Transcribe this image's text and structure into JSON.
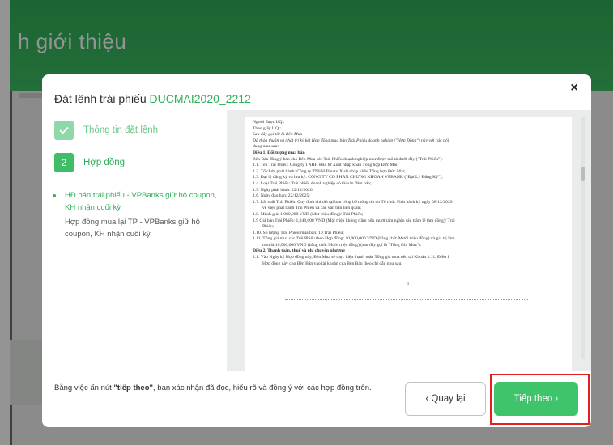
{
  "background": {
    "title": "h giới thiệu",
    "header_color": "#3ebd64"
  },
  "modal": {
    "title_prefix": "Đặt lệnh trái phiếu",
    "bond_code": "DUCMAI2020_2212",
    "close_icon": "×",
    "steps": [
      {
        "number": "",
        "label": "Thông tin đặt lệnh",
        "state": "done",
        "icon": "check-icon"
      },
      {
        "number": "2",
        "label": "Hợp đồng",
        "state": "active"
      }
    ],
    "contracts": [
      {
        "label": "HĐ bán trái phiếu - VPBanks giữ hộ coupon, KH nhận cuối kỳ",
        "active": true
      },
      {
        "label": "Hợp đồng mua lại TP - VPBanks giữ hộ coupon, KH nhận cuối kỳ",
        "active": false
      }
    ],
    "document": {
      "lines": [
        {
          "text": "Người được UQ            :",
          "style": ""
        },
        {
          "text": "Theo giấy UQ              :",
          "style": ""
        },
        {
          "text": "Sau đây gọi tắt là Bên Mua",
          "style": "italic"
        },
        {
          "text": "Đã thỏa thuận và nhất trí ký kết Hợp đồng mua bán Trái Phiếu doanh nghiệp (\"Hợp Đồng\") này với các nội",
          "style": "italic"
        },
        {
          "text": "dung như sau:",
          "style": "italic"
        },
        {
          "text": "Điều 1. Đối tượng mua bán",
          "style": "bold"
        },
        {
          "text": "Bên Bán đồng ý bán cho Bên Mua các Trái Phiếu doanh nghiệp như được mô tả dưới đây (\"Trái Phiếu\"):",
          "style": ""
        },
        {
          "text": "1.1.   Tên Trái Phiếu: Công ty TNHH Đầu tư Xuất nhập khẩu Tổng hợp Đức Mai;",
          "style": ""
        },
        {
          "text": "1.2.   Tổ chức phát hành: Công ty TNHH Đầu tư Xuất nhập khẩu Tổng hợp Đức Mai;",
          "style": ""
        },
        {
          "text": "1.3.   Đại lý đăng ký và lưu ký: CÔNG TY CỔ PHẦN CHỨNG KHOÁN VPBANK (\"Đại Lý Đăng Ký\");",
          "style": ""
        },
        {
          "text": "1.4.   Loại Trái Phiếu: Trái phiếu doanh nghiệp có tài sản đảm bảo;",
          "style": ""
        },
        {
          "text": "1.5.   Ngày phát hành: 22/12/2020;",
          "style": ""
        },
        {
          "text": "1.6.   Ngày đáo hạn: 22/12/2025;",
          "style": ""
        },
        {
          "text": "1.7.   Lãi suất Trái Phiếu: Quy định chi tiết tại bản công bố thông tin do Tổ chức Phát hành ký ngày 08/12/2020",
          "style": ""
        },
        {
          "text": "về việc phát hành Trái Phiếu và các văn bản liên quan;",
          "style": "indent"
        },
        {
          "text": "1.8.   Mệnh giá: 1,000,000 VND (Một triệu đồng)/ Trái Phiếu;",
          "style": ""
        },
        {
          "text": "1.9    Giá bán Trái Phiếu: 1,048,608 VND (Một triệu không trăm bốn mươi tám nghìn sáu trăm lẻ tám đồng)/ Trái",
          "style": ""
        },
        {
          "text": "Phiếu;",
          "style": "indent"
        },
        {
          "text": "1.10. Số lượng Trái Phiếu mua bán: 10 Trái Phiếu;",
          "style": ""
        },
        {
          "text": "1.11. Tổng giá mua các Trái Phiếu theo Hợp đồng: 10,000,000 VND (bằng chữ: Mười triệu đồng) và giá trị làm",
          "style": ""
        },
        {
          "text": "tròn là 10,000,000 VND (bằng chữ: Mười triệu đồng) (sau đây gọi là \"Tổng Giá Mua\").",
          "style": "indent"
        },
        {
          "text": "Điều 2. Thanh toán, thuế và phí chuyển nhượng",
          "style": "bold"
        },
        {
          "text": "2.1.   Vào Ngày ký Hợp đồng này, Bên Mua sẽ thực hiện thanh toán Tổng giá mua nêu tại Khoản 1.11, Điều 1",
          "style": ""
        },
        {
          "text": "Hợp đồng này cho Bên Bán vào tài khoản của Bên Bán theo chỉ dẫn như sau:",
          "style": "indent"
        }
      ],
      "page_number": "1"
    },
    "footer": {
      "text_before": "Bằng việc ấn nút ",
      "text_bold": "\"tiếp theo\"",
      "text_after": ", bạn xác nhận đã đọc, hiểu rõ và đồng ý với các hợp đồng trên.",
      "back_label": "‹  Quay lại",
      "next_label": "Tiếp theo  ›"
    }
  },
  "colors": {
    "accent": "#2fae57",
    "primary_button": "#3fc36b",
    "highlight": "#e01f1f"
  }
}
